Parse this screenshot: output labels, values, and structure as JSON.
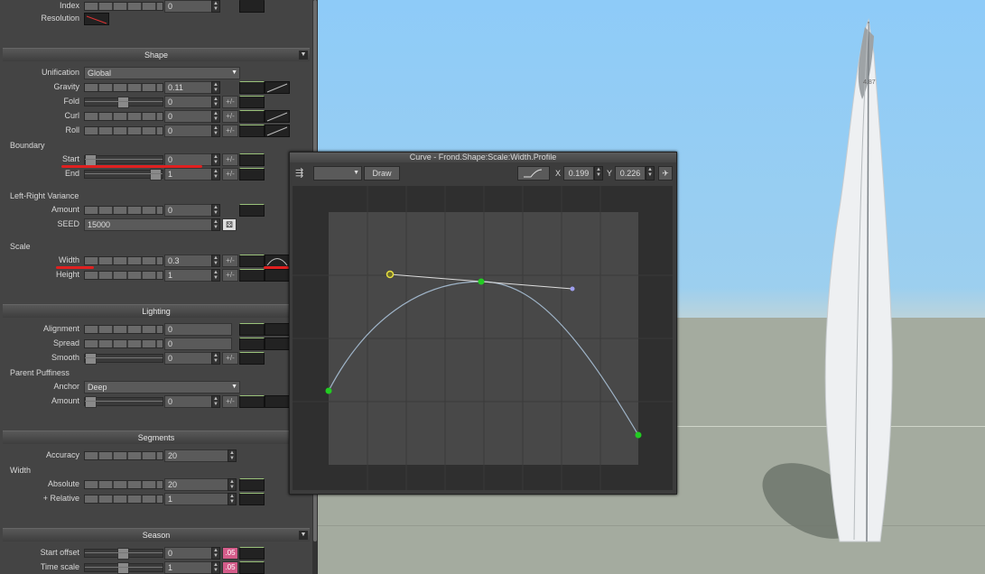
{
  "panel": {
    "top": {
      "index_label": "Index",
      "index_value": "0",
      "resolution_label": "Resolution"
    },
    "shape": {
      "title": "Shape",
      "unification_label": "Unification",
      "unification_value": "Global",
      "gravity_label": "Gravity",
      "gravity_value": "0.11",
      "fold_label": "Fold",
      "fold_value": "0",
      "curl_label": "Curl",
      "curl_value": "0",
      "roll_label": "Roll",
      "roll_value": "0",
      "boundary_group": "Boundary",
      "start_label": "Start",
      "start_value": "0",
      "end_label": "End",
      "end_value": "1",
      "lr_group": "Left-Right Variance",
      "amount_label": "Amount",
      "amount_value": "0",
      "seed_label": "SEED",
      "seed_value": "15000",
      "scale_group": "Scale",
      "width_label": "Width",
      "width_value": "0.3",
      "height_label": "Height",
      "height_value": "1",
      "pm": "+/-"
    },
    "lighting": {
      "title": "Lighting",
      "alignment_label": "Alignment",
      "alignment_value": "0",
      "spread_label": "Spread",
      "spread_value": "0",
      "smooth_label": "Smooth",
      "smooth_value": "0",
      "puffiness_group": "Parent Puffiness",
      "anchor_label": "Anchor",
      "anchor_value": "Deep",
      "amount_label": "Amount",
      "amount_value": "0"
    },
    "segments": {
      "title": "Segments",
      "accuracy_label": "Accuracy",
      "accuracy_value": "20",
      "width_group": "Width",
      "absolute_label": "Absolute",
      "absolute_value": "20",
      "relative_label": "+ Relative",
      "relative_value": "1"
    },
    "season": {
      "title": "Season",
      "start_offset_label": "Start offset",
      "start_offset_value": "0",
      "time_scale_label": "Time scale",
      "time_scale_value": "1",
      "pink_btn": ".05"
    }
  },
  "curve_window": {
    "title": "Curve - Frond.Shape:Scale:Width.Profile",
    "draw_button": "Draw",
    "x_label": "X",
    "x_value": "0.199",
    "y_label": "Y",
    "y_value": "0.226"
  },
  "viewport": {
    "leaf_label": "4.87"
  },
  "colors": {
    "panel_bg": "#444444",
    "sky": "#8ecbf8",
    "ground": "#a4ab9f",
    "curve_point": "#22cc22",
    "selected_handle": "#e8e040",
    "annotation_red": "#e02020",
    "pink_button": "#d45c8a"
  }
}
